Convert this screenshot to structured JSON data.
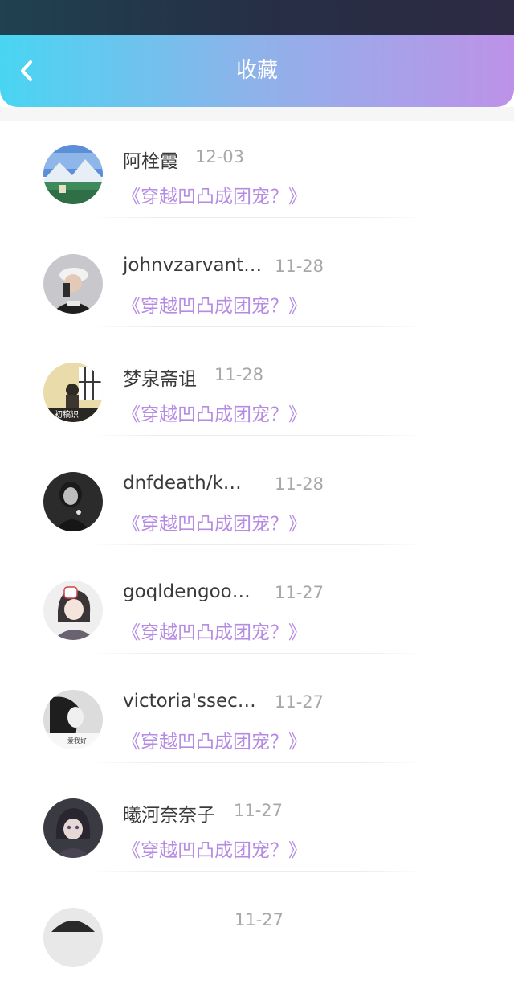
{
  "header": {
    "title": "收藏"
  },
  "favorites": [
    {
      "name": "阿栓霞",
      "date": "12-03",
      "book": "《穿越凹凸成团宠？》",
      "avatar": "avatar-landscape"
    },
    {
      "name": "johnvzarvant…",
      "date": "11-28",
      "book": "《穿越凹凸成团宠？》",
      "avatar": "avatar-cap-person"
    },
    {
      "name": "梦泉斋诅",
      "date": "11-28",
      "book": "《穿越凹凸成团宠？》",
      "avatar": "avatar-window-girl"
    },
    {
      "name": "dnfdeath/k…",
      "date": "11-28",
      "book": "《穿越凹凸成团宠？》",
      "avatar": "avatar-bw-girl"
    },
    {
      "name": "goqldengoo…",
      "date": "11-27",
      "book": "《穿越凹凸成团宠？》",
      "avatar": "avatar-anime-mask"
    },
    {
      "name": "victoria'ssec…",
      "date": "11-27",
      "book": "《穿越凹凸成团宠？》",
      "avatar": "avatar-bw-portrait"
    },
    {
      "name": "曦河奈奈子",
      "date": "11-27",
      "book": "《穿越凹凸成团宠？》",
      "avatar": "avatar-anime-girl"
    }
  ],
  "partial_item": {
    "name": "",
    "date": "11-27"
  }
}
